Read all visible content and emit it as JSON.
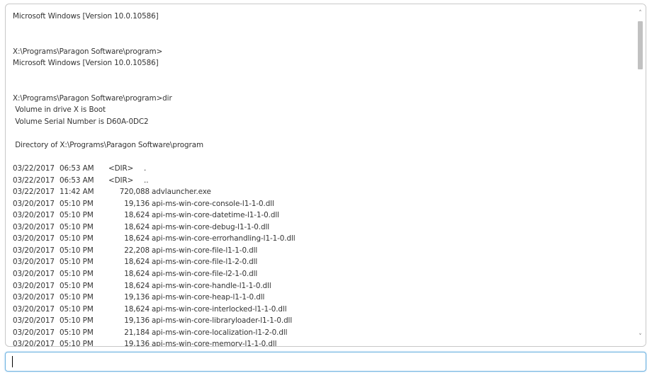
{
  "console": {
    "lines": [
      {
        "type": "text",
        "text": "Microsoft Windows [Version 10.0.10586]"
      },
      {
        "type": "blank"
      },
      {
        "type": "blank"
      },
      {
        "type": "text",
        "text": "X:\\Programs\\Paragon Software\\program>"
      },
      {
        "type": "text",
        "text": "Microsoft Windows [Version 10.0.10586]"
      },
      {
        "type": "blank"
      },
      {
        "type": "blank"
      },
      {
        "type": "text",
        "text": "X:\\Programs\\Paragon Software\\program>dir"
      },
      {
        "type": "text",
        "text": " Volume in drive X is Boot"
      },
      {
        "type": "text",
        "text": " Volume Serial Number is D60A-0DC2"
      },
      {
        "type": "blank"
      },
      {
        "type": "text",
        "text": " Directory of X:\\Programs\\Paragon Software\\program"
      },
      {
        "type": "blank"
      }
    ],
    "listing": [
      {
        "date": "03/22/2017",
        "time": "06:53 AM",
        "dir": "<DIR>",
        "size": "",
        "name": "."
      },
      {
        "date": "03/22/2017",
        "time": "06:53 AM",
        "dir": "<DIR>",
        "size": "",
        "name": ".."
      },
      {
        "date": "03/22/2017",
        "time": "11:42 AM",
        "dir": "",
        "size": "720,088",
        "name": "advlauncher.exe"
      },
      {
        "date": "03/20/2017",
        "time": "05:10 PM",
        "dir": "",
        "size": "19,136",
        "name": "api-ms-win-core-console-l1-1-0.dll"
      },
      {
        "date": "03/20/2017",
        "time": "05:10 PM",
        "dir": "",
        "size": "18,624",
        "name": "api-ms-win-core-datetime-l1-1-0.dll"
      },
      {
        "date": "03/20/2017",
        "time": "05:10 PM",
        "dir": "",
        "size": "18,624",
        "name": "api-ms-win-core-debug-l1-1-0.dll"
      },
      {
        "date": "03/20/2017",
        "time": "05:10 PM",
        "dir": "",
        "size": "18,624",
        "name": "api-ms-win-core-errorhandling-l1-1-0.dll"
      },
      {
        "date": "03/20/2017",
        "time": "05:10 PM",
        "dir": "",
        "size": "22,208",
        "name": "api-ms-win-core-file-l1-1-0.dll"
      },
      {
        "date": "03/20/2017",
        "time": "05:10 PM",
        "dir": "",
        "size": "18,624",
        "name": "api-ms-win-core-file-l1-2-0.dll"
      },
      {
        "date": "03/20/2017",
        "time": "05:10 PM",
        "dir": "",
        "size": "18,624",
        "name": "api-ms-win-core-file-l2-1-0.dll"
      },
      {
        "date": "03/20/2017",
        "time": "05:10 PM",
        "dir": "",
        "size": "18,624",
        "name": "api-ms-win-core-handle-l1-1-0.dll"
      },
      {
        "date": "03/20/2017",
        "time": "05:10 PM",
        "dir": "",
        "size": "19,136",
        "name": "api-ms-win-core-heap-l1-1-0.dll"
      },
      {
        "date": "03/20/2017",
        "time": "05:10 PM",
        "dir": "",
        "size": "18,624",
        "name": "api-ms-win-core-interlocked-l1-1-0.dll"
      },
      {
        "date": "03/20/2017",
        "time": "05:10 PM",
        "dir": "",
        "size": "19,136",
        "name": "api-ms-win-core-libraryloader-l1-1-0.dll"
      },
      {
        "date": "03/20/2017",
        "time": "05:10 PM",
        "dir": "",
        "size": "21,184",
        "name": "api-ms-win-core-localization-l1-2-0.dll"
      },
      {
        "date": "03/20/2017",
        "time": "05:10 PM",
        "dir": "",
        "size": "19,136",
        "name": "api-ms-win-core-memory-l1-1-0.dll"
      }
    ]
  },
  "scrollbar": {
    "up_icon": "chevron-up-icon",
    "down_icon": "chevron-down-icon",
    "up_glyph": "˄",
    "down_glyph": "˅"
  },
  "command_input": {
    "value": "",
    "placeholder": ""
  }
}
